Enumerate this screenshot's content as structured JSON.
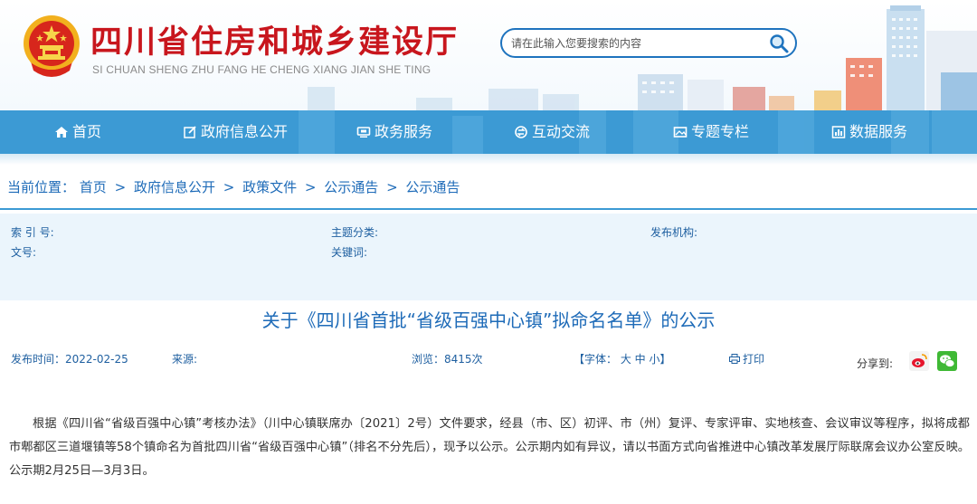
{
  "header": {
    "title": "四川省住房和城乡建设厅",
    "subtitle": "SI CHUAN SHENG ZHU FANG HE CHENG XIANG JIAN SHE TING",
    "search_placeholder": "请在此输入您要搜索的内容",
    "colors": {
      "title": "#c8161d",
      "accent": "#1e73be"
    }
  },
  "nav": {
    "items": [
      {
        "label": "首页",
        "icon": "home-icon"
      },
      {
        "label": "政府信息公开",
        "icon": "edit-icon"
      },
      {
        "label": "政务服务",
        "icon": "monitor-icon"
      },
      {
        "label": "互动交流",
        "icon": "exchange-icon"
      },
      {
        "label": "专题专栏",
        "icon": "image-icon"
      },
      {
        "label": "数据服务",
        "icon": "chart-icon"
      }
    ],
    "color": "#3c9ad4"
  },
  "breadcrumb": {
    "label": "当前位置：",
    "items": [
      "首页",
      "政府信息公开",
      "政策文件",
      "公示通告",
      "公示通告"
    ],
    "separator": ">"
  },
  "meta": {
    "index_label": "索 引 号:",
    "topic_label": "主题分类:",
    "issuer_label": "发布机构:",
    "docno_label": "文号:",
    "keywords_label": "关键词:"
  },
  "article": {
    "title": "关于《四川省首批“省级百强中心镇”拟命名名单》的公示",
    "publish_time": "发布时间：2022-02-25",
    "source": "来源:",
    "views": "浏览：8415次",
    "font_size": "【字体： 大 中 小】",
    "print": "打印",
    "share": "分享到:",
    "body": "根据《四川省“省级百强中心镇”考核办法》（川中心镇联席办〔2021〕2号）文件要求，经县（市、区）初评、市（州）复评、专家评审、实地核查、会议审议等程序，拟将成都市郫都区三道堰镇等58个镇命名为首批四川省“省级百强中心镇”（排名不分先后），现予以公示。公示期内如有异议，请以书面方式向省推进中心镇改革发展厅际联席会议办公室反映。公示期2月25日—3月3日。"
  }
}
